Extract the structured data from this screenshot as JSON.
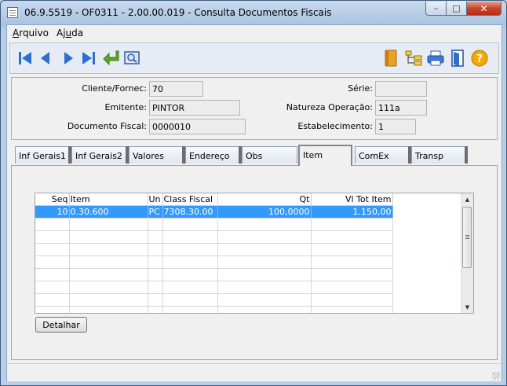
{
  "window": {
    "title": "06.9.5519 - OF0311 - 2.00.00.019 - Consulta Documentos Fiscais",
    "minimize": "–",
    "maximize": "□",
    "close": "✕"
  },
  "menu": {
    "arquivo_first": "A",
    "arquivo_rest": "rquivo",
    "ajuda_first": "Aj",
    "ajuda_mid": "u",
    "ajuda_rest": "da"
  },
  "toolbar": {
    "icons": [
      "first-record-icon",
      "previous-record-icon",
      "next-record-icon",
      "last-record-icon",
      "return-icon",
      "zoom-preview-icon",
      "book-icon",
      "tree-structure-icon",
      "printer-icon",
      "exit-door-icon",
      "help-icon"
    ],
    "accent_color": "#2d6fd0"
  },
  "form": {
    "cliente_label": "Cliente/Fornec:",
    "cliente_value": "70",
    "emitente_label": "Emitente:",
    "emitente_value": "PINTOR",
    "documento_label": "Documento Fiscal:",
    "documento_value": "0000010",
    "serie_label": "Série:",
    "serie_value": "",
    "natureza_label": "Natureza Operação:",
    "natureza_value": "111a",
    "estabelecimento_label": "Estabelecimento:",
    "estabelecimento_value": "1"
  },
  "tabs": [
    {
      "label": "Inf Gerais1"
    },
    {
      "label": "Inf Gerais2"
    },
    {
      "label": "Valores"
    },
    {
      "label": "Endereço"
    },
    {
      "label": "Obs"
    },
    {
      "label": "Item"
    },
    {
      "label": "ComEx"
    },
    {
      "label": "Transp"
    }
  ],
  "active_tab": "Item",
  "grid": {
    "headers": {
      "seq": "Seq",
      "item": "Item",
      "un": "Un",
      "class_fiscal": "Class Fiscal",
      "qt": "Qt",
      "vl_tot_item": "Vl Tot Item"
    },
    "rows": [
      {
        "seq": "10",
        "item": "0.30.600",
        "un": "PC",
        "class_fiscal": "7308.30.00",
        "qt": "100,0000",
        "vl_tot_item": "1.150,00"
      }
    ],
    "selected_color": "#3399ff"
  },
  "buttons": {
    "detalhar": "Detalhar"
  }
}
